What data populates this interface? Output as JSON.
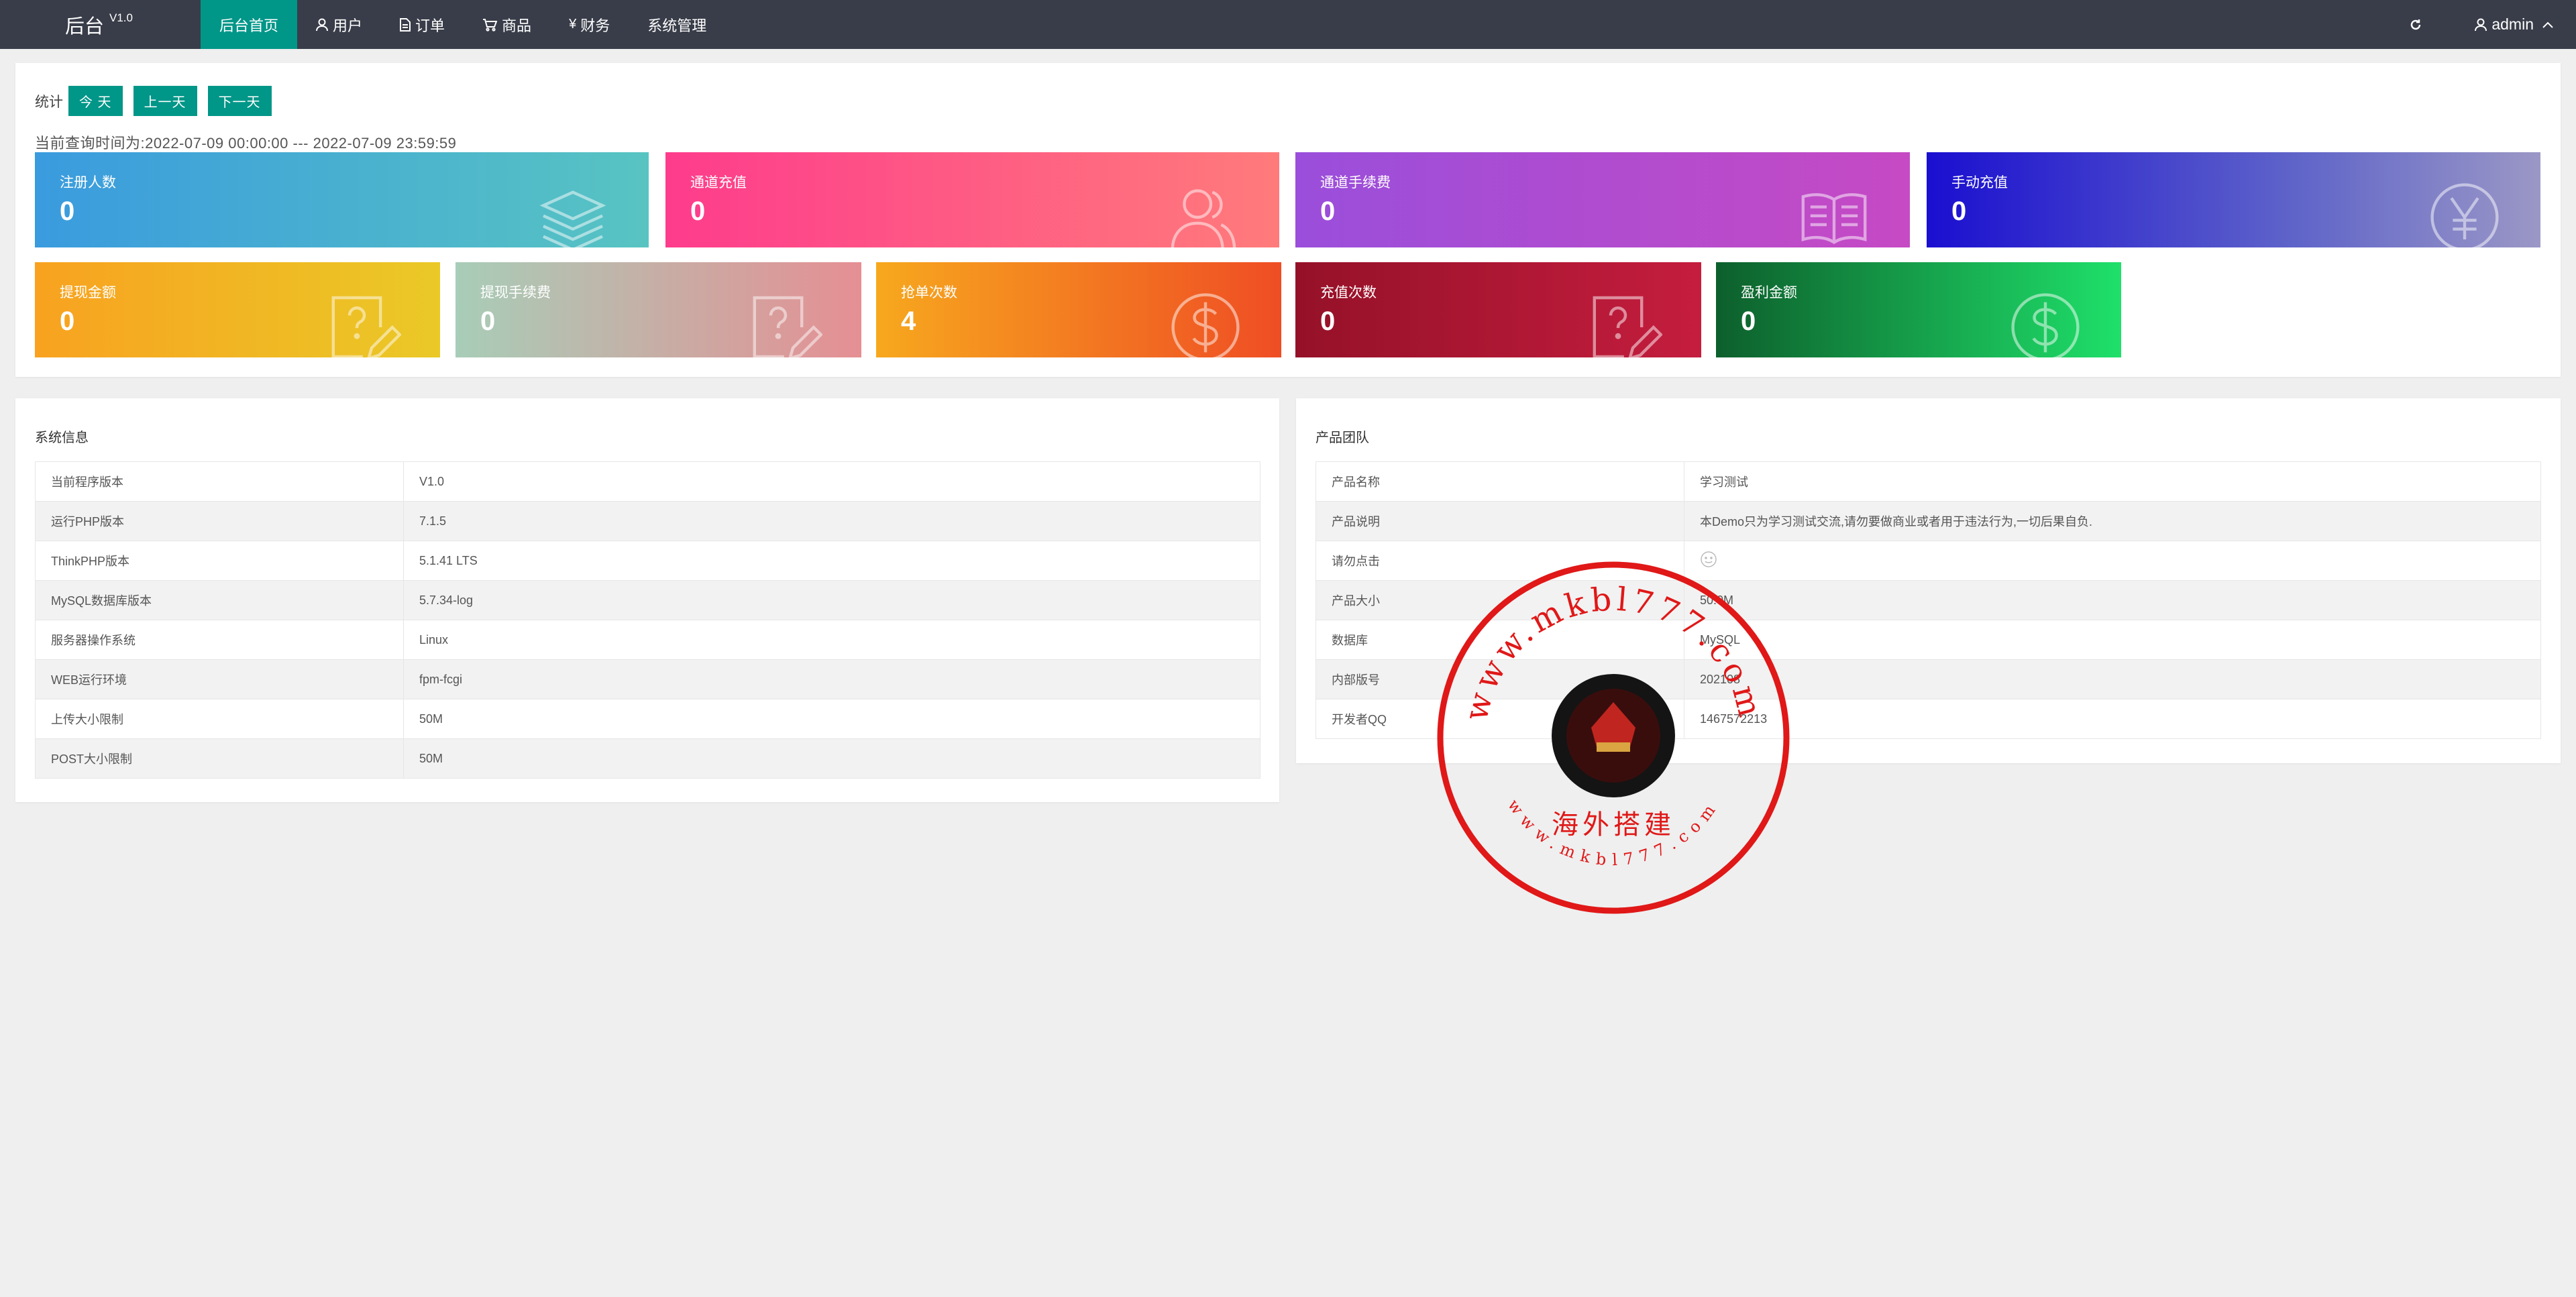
{
  "colors": {
    "nav_bg": "#393d49",
    "accent": "#009688",
    "page_bg": "#efefef",
    "stamp_red": "#e01818"
  },
  "app": {
    "title": "后台",
    "version": "V1.0"
  },
  "nav": [
    {
      "label": "后台首页",
      "icon": "",
      "active": true
    },
    {
      "label": "用户",
      "icon": "user-icon"
    },
    {
      "label": "订单",
      "icon": "document-icon"
    },
    {
      "label": "商品",
      "icon": "cart-icon"
    },
    {
      "label": "财务",
      "icon": "yen-icon"
    },
    {
      "label": "系统管理",
      "icon": ""
    }
  ],
  "topright": {
    "refresh_icon": "refresh-icon",
    "username": "admin"
  },
  "stats": {
    "label": "统计",
    "buttons": {
      "today": "今 天",
      "prev": "上一天",
      "next": "下一天"
    },
    "range_text": "当前查询时间为:2022-07-09 00:00:00 --- 2022-07-09 23:59:59",
    "cards": [
      {
        "title": "注册人数",
        "value": "0",
        "icon": "layers-icon"
      },
      {
        "title": "通道充值",
        "value": "0",
        "icon": "users-icon"
      },
      {
        "title": "通道手续费",
        "value": "0",
        "icon": "book-icon"
      },
      {
        "title": "手动充值",
        "value": "0",
        "icon": "yen-circle-icon"
      },
      {
        "title": "提现金额",
        "value": "0",
        "icon": "question-edit-icon"
      },
      {
        "title": "提现手续费",
        "value": "0",
        "icon": "question-edit-icon"
      },
      {
        "title": "抢单次数",
        "value": "4",
        "icon": "dollar-circle-icon"
      },
      {
        "title": "充值次数",
        "value": "0",
        "icon": "question-edit-icon"
      },
      {
        "title": "盈利金额",
        "value": "0",
        "icon": "dollar-circle-icon"
      }
    ]
  },
  "sysinfo": {
    "title": "系统信息",
    "rows": [
      {
        "key": "当前程序版本",
        "value": "V1.0"
      },
      {
        "key": "运行PHP版本",
        "value": "7.1.5"
      },
      {
        "key": "ThinkPHP版本",
        "value": "5.1.41 LTS"
      },
      {
        "key": "MySQL数据库版本",
        "value": "5.7.34-log"
      },
      {
        "key": "服务器操作系统",
        "value": "Linux"
      },
      {
        "key": "WEB运行环境",
        "value": "fpm-fcgi"
      },
      {
        "key": "上传大小限制",
        "value": "50M"
      },
      {
        "key": "POST大小限制",
        "value": "50M"
      }
    ]
  },
  "team": {
    "title": "产品团队",
    "rows": [
      {
        "key": "产品名称",
        "value": "学习测试"
      },
      {
        "key": "产品说明",
        "value": "本Demo只为学习测试交流,请勿要做商业或者用于违法行为,一切后果自负."
      },
      {
        "key": "请勿点击",
        "value": "",
        "icon": "emoji-icon"
      },
      {
        "key": "产品大小",
        "value": "50.0M"
      },
      {
        "key": "数据库",
        "value": "MySQL"
      },
      {
        "key": "内部版号",
        "value": "202108"
      },
      {
        "key": "开发者QQ",
        "value": "1467572213"
      }
    ]
  },
  "watermark": {
    "top_text": "www.mkbl777.com",
    "center_text": "海外搭建",
    "bottom_text": "www.mkbl777.com"
  }
}
